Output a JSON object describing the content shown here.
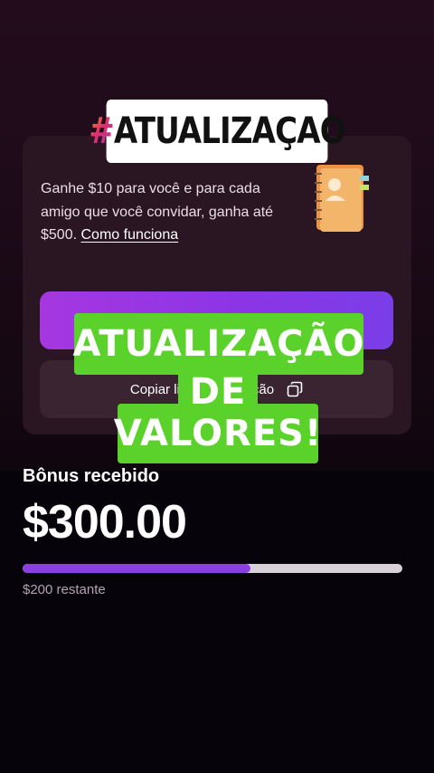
{
  "overlay": {
    "top_badge_hash": "#",
    "top_badge_text": "ATUALIZAÇAO",
    "green_line_1": "ATUALIZAÇÃO",
    "green_line_2": "DE",
    "green_line_3": "VALORES!"
  },
  "referral_card": {
    "description": "Ganhe $10 para você e para cada amigo que você convidar, ganha até $500.",
    "link_label": "Como funciona",
    "primary_button_label": "",
    "copy_button_label": "Copiar link de indicação",
    "icons": {
      "illustration": "notebook-icon",
      "copy": "copy-icon"
    },
    "colors": {
      "primary": "#8a35e6",
      "card": "#2a1523"
    }
  },
  "bonus": {
    "label": "Bônus recebido",
    "value": "$300.00",
    "progress_fraction": 0.6,
    "remaining_text": "$200 restante",
    "colors": {
      "fill": "#8b3fe0",
      "track": "#d8d0d8"
    }
  }
}
